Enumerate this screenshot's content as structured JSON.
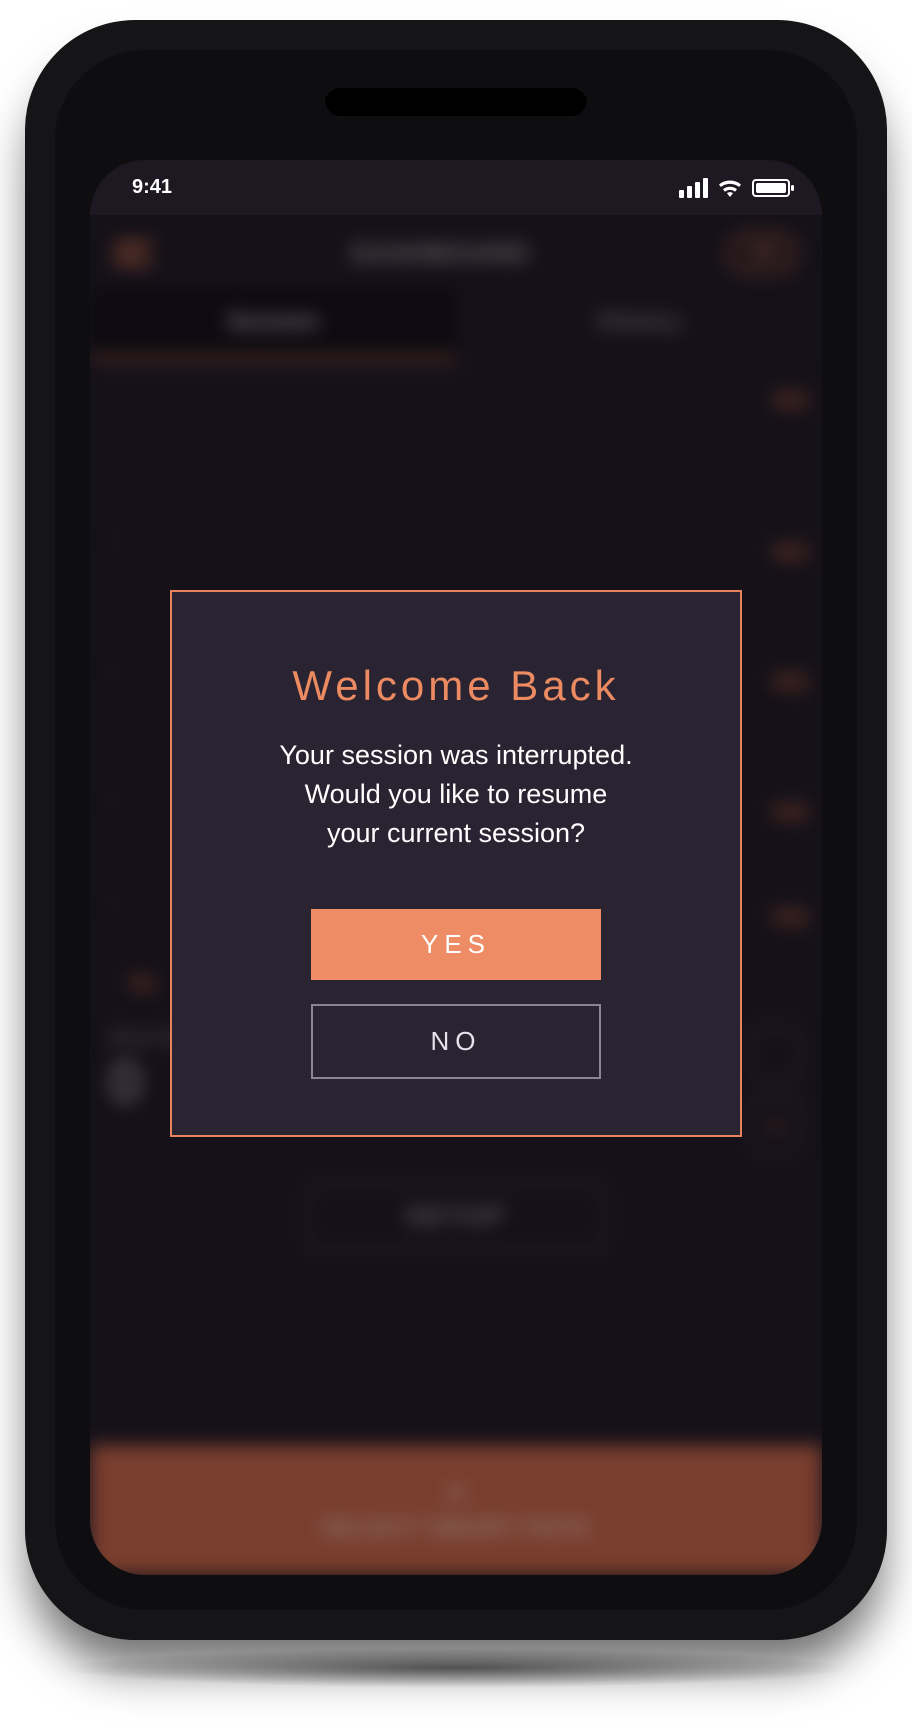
{
  "statusbar": {
    "time": "9:41"
  },
  "header": {
    "title": "DASHBOARD",
    "badge": "100"
  },
  "tabs": {
    "session": "Session",
    "history": "History"
  },
  "chart_axis": {
    "y": [
      "450",
      "400",
      "350",
      "300",
      "250"
    ],
    "x_left": "0s",
    "x_right": ""
  },
  "readouts": {
    "left_label": "Bowl Size",
    "left_value": "0",
    "right_label": "Target Temp",
    "right_value": "0",
    "right_unit": "°"
  },
  "buttons": {
    "setup": "SETUP",
    "bottom_label": "SELECT SMART PATH"
  },
  "modal": {
    "title": "Welcome Back",
    "body_line1": "Your session was interrupted.",
    "body_line2": "Would you like to resume",
    "body_line3": "your current session?",
    "yes": "YES",
    "no": "NO"
  }
}
